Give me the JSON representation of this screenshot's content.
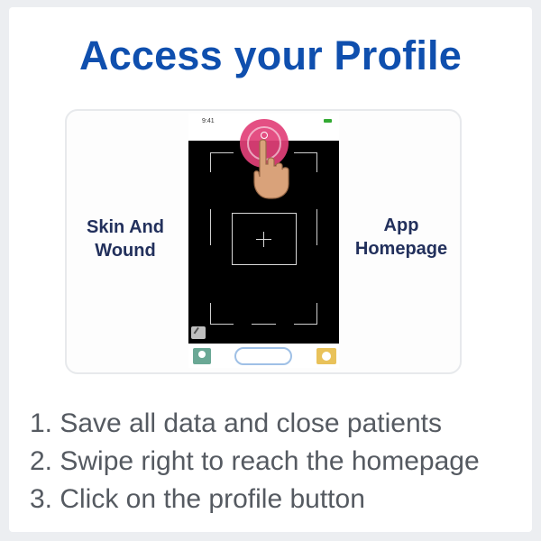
{
  "title": "Access your Profile",
  "left_label": {
    "line1": "Skin And",
    "line2": "Wound"
  },
  "right_label": {
    "line1": "App",
    "line2": "Homepage"
  },
  "phone": {
    "status_time": "9:41",
    "icons": {
      "profile": "profile-icon",
      "flash": "flash-off-icon",
      "nav_left": "patient-icon",
      "nav_right": "settings-icon"
    }
  },
  "steps": [
    "1. Save all data and close patients",
    "2. Swipe right to reach the homepage",
    "3. Click on the profile button"
  ],
  "colors": {
    "title": "#0f4fae",
    "labels": "#22305c",
    "highlight": "#e24078",
    "nav_left": "#6aa895",
    "nav_right": "#e9c25a"
  }
}
